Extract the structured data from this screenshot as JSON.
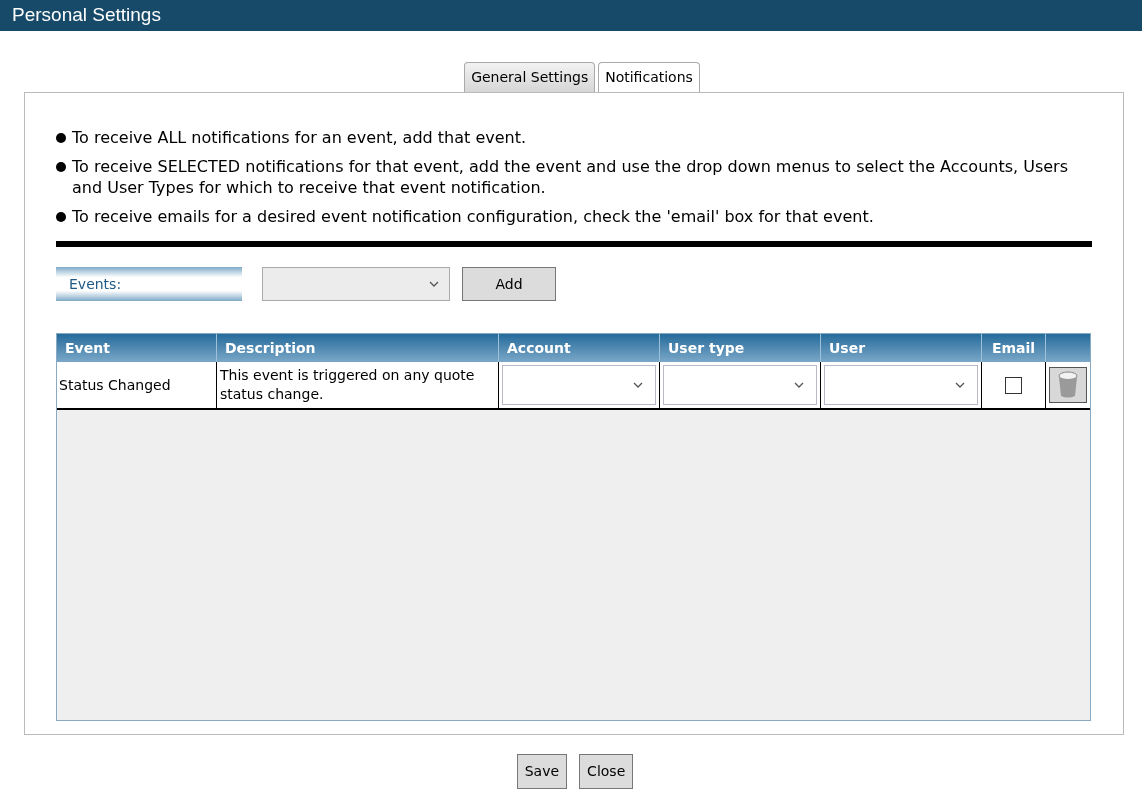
{
  "window": {
    "title": "Personal Settings"
  },
  "tabs": [
    {
      "label": "General Settings",
      "selected": false
    },
    {
      "label": "Notifications",
      "selected": true
    }
  ],
  "instructions": [
    "To receive ALL notifications for an event, add that event.",
    "To receive SELECTED notifications for that event, add the event and use the drop down menus to select the Accounts, Users and User Types for which to receive that event notification.",
    "To receive emails for a desired event notification configuration, check the 'email' box for that event."
  ],
  "events_label": "Events:",
  "add_button": "Add",
  "table": {
    "columns": [
      "Event",
      "Description",
      "Account",
      "User type",
      "User",
      "Email"
    ],
    "rows": [
      {
        "event": "Status Changed",
        "description": "This event is triggered on any quote status change.",
        "email_checked": false
      }
    ]
  },
  "buttons": [
    "Save",
    "Close"
  ]
}
